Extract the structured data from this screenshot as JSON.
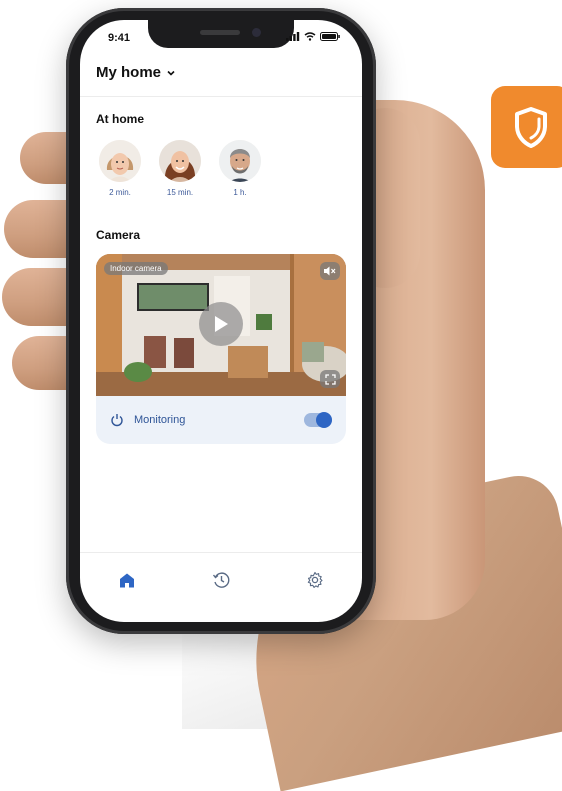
{
  "status_bar": {
    "time": "9:41"
  },
  "header": {
    "title": "My home"
  },
  "at_home": {
    "title": "At home",
    "people": [
      {
        "time": "2 min."
      },
      {
        "time": "15 min."
      },
      {
        "time": "1 h."
      }
    ]
  },
  "camera": {
    "title": "Camera",
    "label": "Indoor camera",
    "monitoring_label": "Monitoring",
    "monitoring_enabled": true
  },
  "tabbar": {
    "items": [
      {
        "icon": "home-icon",
        "active": true
      },
      {
        "icon": "history-icon",
        "active": false
      },
      {
        "icon": "gear-icon",
        "active": false
      }
    ]
  },
  "colors": {
    "accent": "#2e66c4",
    "badge": "#f08a2d",
    "monitor_bg": "#edf2f9"
  }
}
